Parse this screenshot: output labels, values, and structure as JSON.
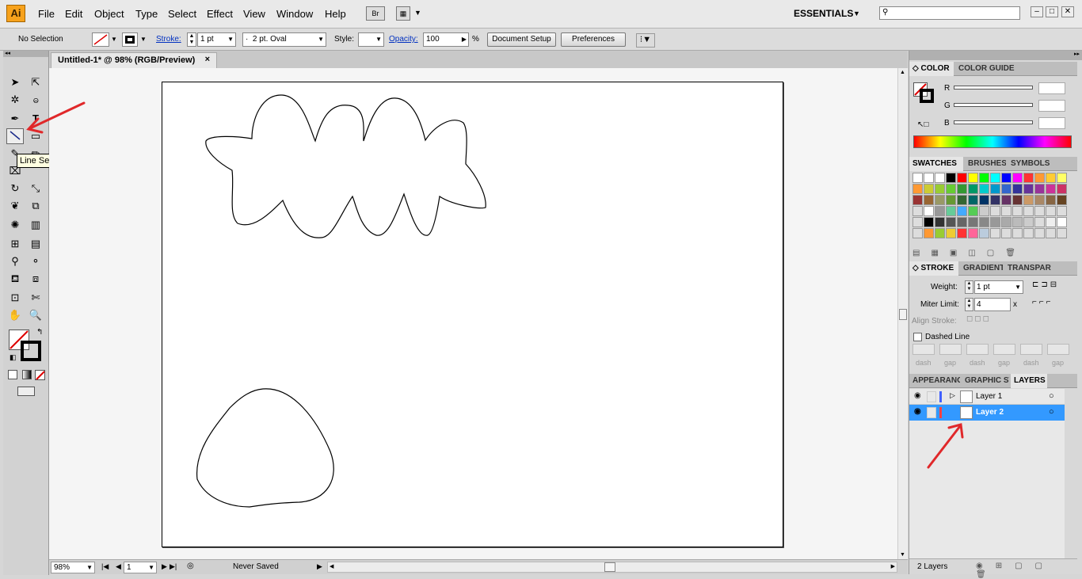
{
  "app": {
    "logo": "Ai",
    "workspace": "ESSENTIALS"
  },
  "menus": [
    "File",
    "Edit",
    "Object",
    "Type",
    "Select",
    "Effect",
    "View",
    "Window",
    "Help"
  ],
  "bridge_label": "Br",
  "control": {
    "selection": "No Selection",
    "stroke_label": "Stroke:",
    "stroke_weight": "1 pt",
    "brush": "2 pt. Oval",
    "style_label": "Style:",
    "opacity_label": "Opacity:",
    "opacity_value": "100",
    "percent": "%",
    "document_setup": "Document Setup",
    "preferences": "Preferences"
  },
  "document": {
    "tab_title": "Untitled-1* @ 98% (RGB/Preview)",
    "close": "×"
  },
  "tooltip": "Line Segment Tool (\\)",
  "status": {
    "zoom": "98%",
    "page": "1",
    "state": "Never Saved"
  },
  "color_panel": {
    "tabs": [
      "COLOR",
      "COLOR GUIDE"
    ],
    "channels": [
      "R",
      "G",
      "B"
    ]
  },
  "swatches_panel": {
    "tabs": [
      "SWATCHES",
      "BRUSHES",
      "SYMBOLS"
    ]
  },
  "stroke_panel": {
    "tabs": [
      "STROKE",
      "GRADIENT",
      "TRANSPAR"
    ],
    "weight_label": "Weight:",
    "weight_value": "1 pt",
    "miter_label": "Miter Limit:",
    "miter_value": "4",
    "miter_unit": "x",
    "align_label": "Align Stroke:",
    "dashed_label": "Dashed Line",
    "dash_labels": [
      "dash",
      "gap",
      "dash",
      "gap",
      "dash",
      "gap"
    ]
  },
  "layers_panel": {
    "tabs": [
      "APPEARANC",
      "GRAPHIC ST",
      "LAYERS"
    ],
    "layers": [
      {
        "name": "Layer 1",
        "selected": false
      },
      {
        "name": "Layer 2",
        "selected": true
      }
    ],
    "count": "2 Layers"
  },
  "colors": {
    "accent": "#f7a21c",
    "selection": "#3399ff",
    "annotation": "#e0282a",
    "layer1": "#4060ff",
    "layer2": "#ff4040"
  }
}
